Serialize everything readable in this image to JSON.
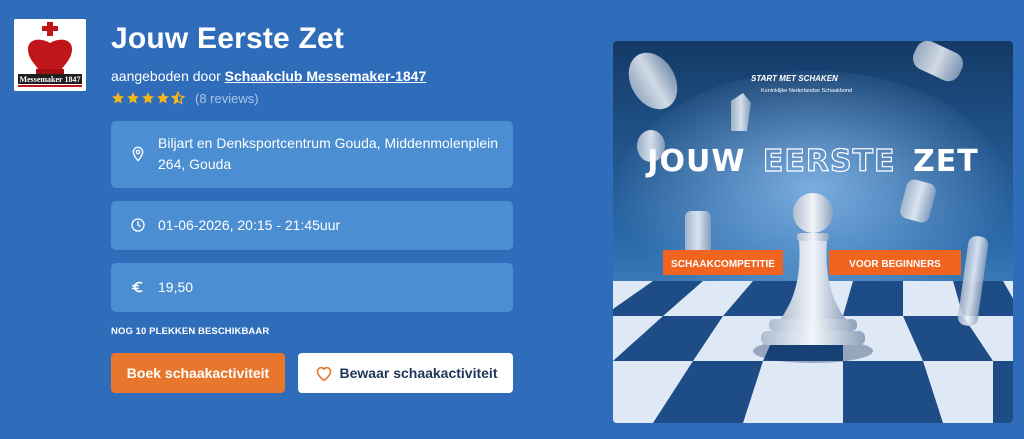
{
  "logo": {
    "icon": "chess-king-icon",
    "text": "Messemaker 1847",
    "colors": {
      "crest": "#c0161b",
      "band": "#1f1f1f"
    }
  },
  "title": "Jouw Eerste Zet",
  "offered_by": {
    "prefix": "aangeboden door",
    "club": "Schaakclub Messemaker-1847"
  },
  "rating": {
    "stars": 4.5,
    "max": 5,
    "reviews_label": "(8 reviews)",
    "star_color": "#f5b81c"
  },
  "details": {
    "location": {
      "icon": "map-pin-icon",
      "text": "Biljart en Denksportcentrum Gouda, Middenmolenplein 264, Gouda"
    },
    "datetime": {
      "icon": "clock-icon",
      "text": "01-06-2026, 20:15 - 21:45uur"
    },
    "price": {
      "icon": "euro-icon",
      "text": "19,50"
    }
  },
  "availability": "NOG 10 PLEKKEN BESCHIKBAAR",
  "buttons": {
    "book": "Boek schaakactiviteit",
    "save": "Bewaar schaakactiviteit",
    "save_icon": "heart-icon"
  },
  "hero": {
    "kicker": "START MET SCHAKEN",
    "org": "Koninklijke Nederlandse Schaakbond",
    "headline_1": "JOUW",
    "headline_2": "EERSTE",
    "headline_3": "ZET",
    "tag_left": "SCHAAKCOMPETITIE",
    "tag_right": "VOOR BEGINNERS",
    "colors": {
      "accent": "#f0641f",
      "sky": "#1f4f86"
    }
  },
  "colors": {
    "background": "#2f6dbb",
    "card": "#4b8ed2",
    "primary_button": "#e8772e"
  }
}
